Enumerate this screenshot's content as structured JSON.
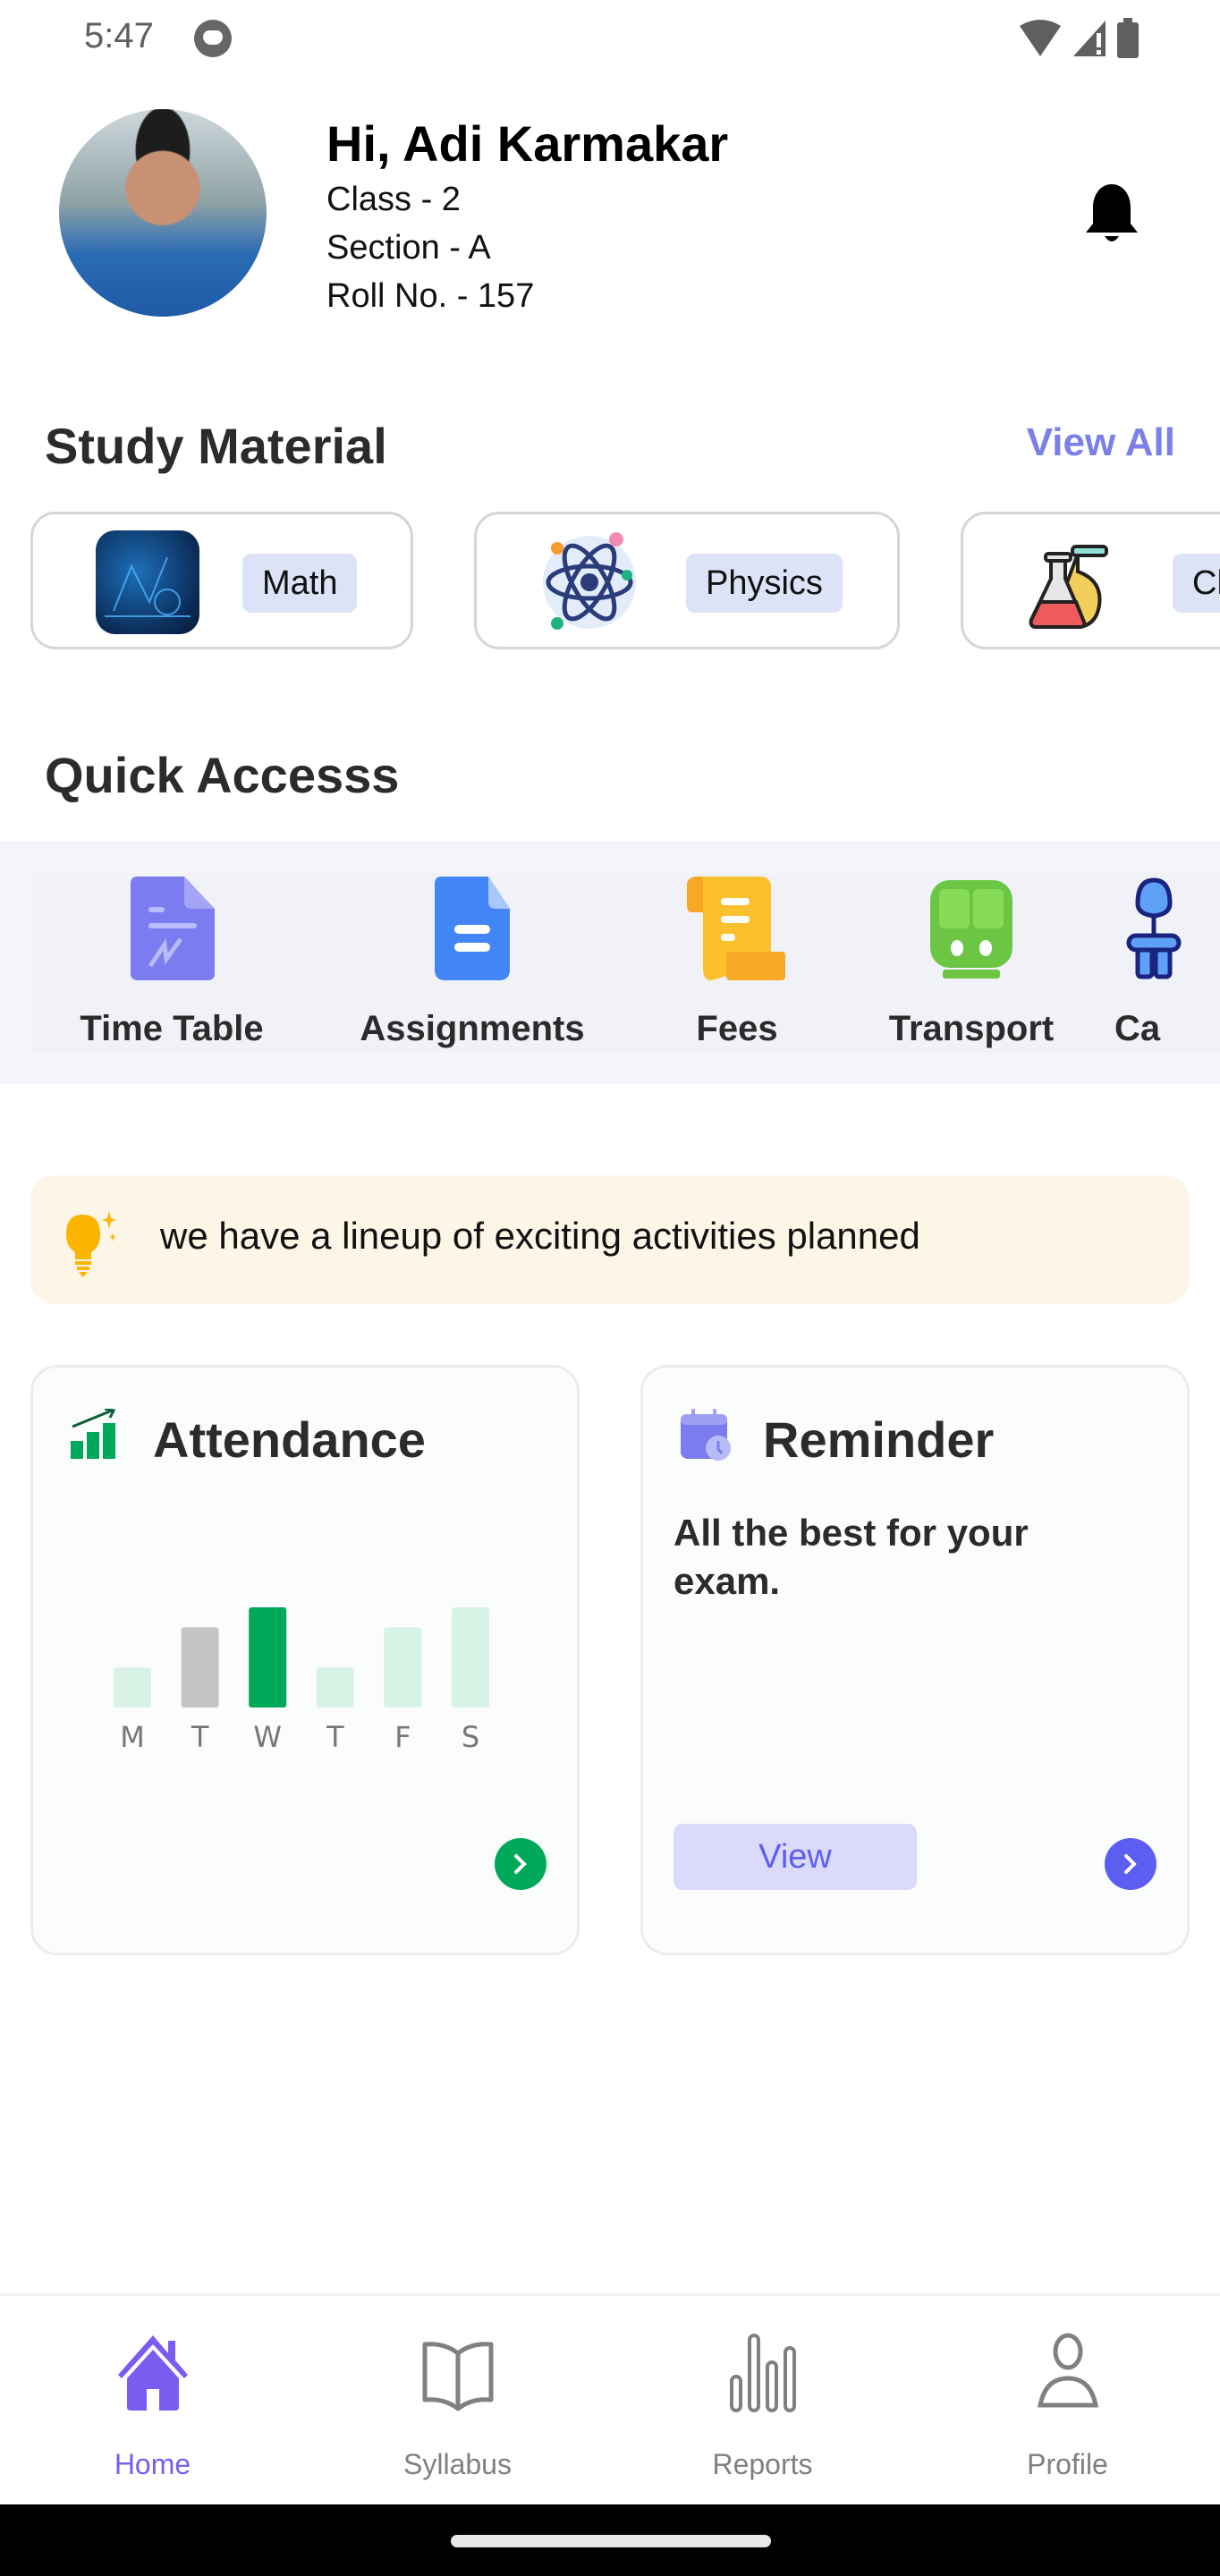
{
  "status_bar": {
    "time": "5:47",
    "icons": [
      "app-notification-icon",
      "wifi-icon",
      "signal-icon",
      "battery-icon"
    ]
  },
  "profile": {
    "greeting": "Hi, Adi Karmakar",
    "class_line": "Class - 2",
    "section_line": "Section - A",
    "roll_line": "Roll No. - 157",
    "notification_icon": "bell-icon"
  },
  "study_material": {
    "title": "Study Material",
    "view_all": "View All",
    "items": [
      {
        "label": "Math",
        "icon": "math-thumbnail"
      },
      {
        "label": "Physics",
        "icon": "atom-icon"
      },
      {
        "label": "Ch",
        "icon": "chemistry-flasks-icon"
      }
    ]
  },
  "quick_access": {
    "title": "Quick Accesss",
    "items": [
      {
        "label": "Time Table",
        "icon": "timetable-document-icon",
        "color": "#7b7cf0"
      },
      {
        "label": "Assignments",
        "icon": "assignment-document-icon",
        "color": "#4285f4"
      },
      {
        "label": "Fees",
        "icon": "fees-scroll-icon",
        "color": "#fbc02d"
      },
      {
        "label": "Transport",
        "icon": "train-icon",
        "color": "#6cc644"
      },
      {
        "label": "Ca",
        "icon": "canteen-icon",
        "color": "#4a8ef0"
      }
    ]
  },
  "banner": {
    "icon": "lightbulb-icon",
    "text": "we have a lineup of exciting activities planned"
  },
  "attendance": {
    "title": "Attendance",
    "icon": "growth-chart-icon",
    "arrow_icon": "chevron-right-icon"
  },
  "reminder": {
    "title": "Reminder",
    "icon": "calendar-clock-icon",
    "message": "All the best for your exam.",
    "view_label": "View",
    "arrow_icon": "chevron-right-icon"
  },
  "chart_data": {
    "type": "bar",
    "title": "Attendance",
    "categories": [
      "M",
      "T",
      "W",
      "T",
      "F",
      "S"
    ],
    "values": [
      2,
      4,
      5,
      2,
      4,
      5
    ],
    "highlight": [
      "light",
      "gray",
      "active",
      "light",
      "light",
      "light"
    ],
    "ylim": [
      0,
      5
    ],
    "xlabel": "",
    "ylabel": "",
    "grid": false,
    "colors": {
      "active": "#00a85a",
      "gray": "#c4c4c4",
      "light": "#d9f2e6"
    }
  },
  "bottom_nav": {
    "items": [
      {
        "label": "Home",
        "icon": "home-icon",
        "active": true
      },
      {
        "label": "Syllabus",
        "icon": "book-icon",
        "active": false
      },
      {
        "label": "Reports",
        "icon": "bar-chart-icon",
        "active": false
      },
      {
        "label": "Profile",
        "icon": "person-icon",
        "active": false
      }
    ]
  },
  "colors": {
    "accent": "#7b5cf0",
    "link": "#7b7fe8",
    "green": "#00a85a",
    "purple_button": "#5b5ef0",
    "banner_bg": "#fdf6e6"
  }
}
